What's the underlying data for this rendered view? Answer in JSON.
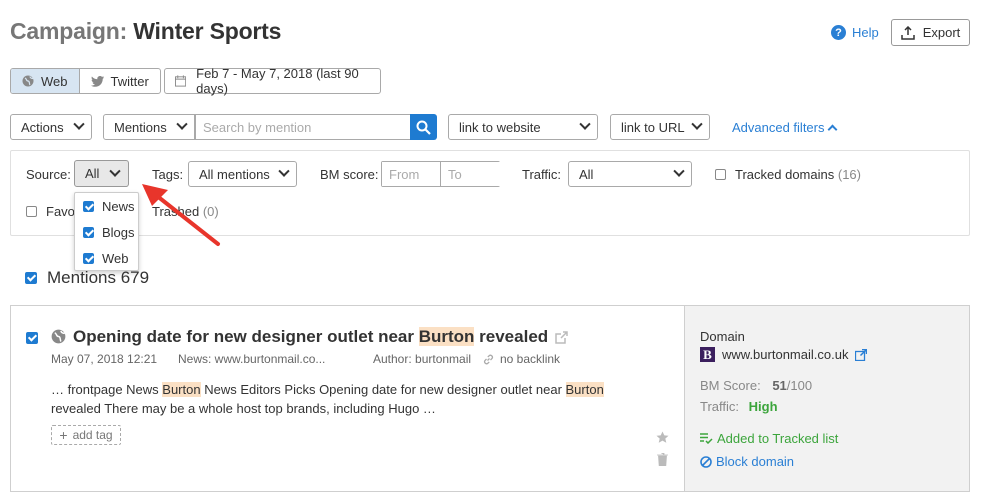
{
  "header": {
    "title_prefix": "Campaign:",
    "title_name": "Winter Sports",
    "help_label": "Help",
    "export_label": "Export"
  },
  "channel_tabs": [
    {
      "label": "Web",
      "icon": "globe-icon",
      "selected": true
    },
    {
      "label": "Twitter",
      "icon": "twitter-icon",
      "selected": false
    }
  ],
  "date_range": "Feb 7 - May 7, 2018 (last 90 days)",
  "toolbar": {
    "actions_label": "Actions",
    "mentions_label": "Mentions",
    "search_placeholder": "Search by mention",
    "link_to_website": "link to website",
    "link_to_url": "link to URL",
    "advanced_filters": "Advanced filters"
  },
  "filters": {
    "source_label": "Source:",
    "source_value": "All",
    "tags_label": "Tags:",
    "tags_value": "All mentions",
    "bm_score_label": "BM score:",
    "from_placeholder": "From",
    "to_placeholder": "To",
    "traffic_label": "Traffic:",
    "traffic_value": "All",
    "tracked_domains_label": "Tracked domains",
    "tracked_domains_count": "(16)",
    "favorites_label": "Favo",
    "trashed_label": "Trashed",
    "trashed_count": "(0)"
  },
  "source_dropdown": [
    {
      "label": "News",
      "checked": true
    },
    {
      "label": "Blogs",
      "checked": true
    },
    {
      "label": "Web",
      "checked": true
    }
  ],
  "mentions_header": "Mentions 679",
  "mention": {
    "title_before": "Opening date for new designer outlet near ",
    "title_highlight": "Burton",
    "title_after": " revealed",
    "date": "May 07, 2018 12:21",
    "source": "News: www.burtonmail.co...",
    "author": "Author: burtonmail",
    "backlink": "no backlink",
    "snippet_parts": [
      "… frontpage News ",
      "Burton",
      " News Editors Picks Opening date for new designer outlet near ",
      "Burton",
      " revealed There may be a whole host top brands, including Hugo …"
    ],
    "add_tag": "add tag"
  },
  "side": {
    "domain_label": "Domain",
    "domain_value": "www.burtonmail.co.uk",
    "bm_label": "BM Score:",
    "bm_value": "51",
    "bm_max": "/100",
    "traffic_label": "Traffic:",
    "traffic_value": "High",
    "tracked_action": "Added to Tracked list",
    "block_action": "Block domain"
  },
  "colors": {
    "accent": "#1e7bd1",
    "link": "#2a7fd4",
    "highlight": "#fbe0c4",
    "success": "#3ca53c",
    "annotation_arrow": "#e8352b"
  }
}
